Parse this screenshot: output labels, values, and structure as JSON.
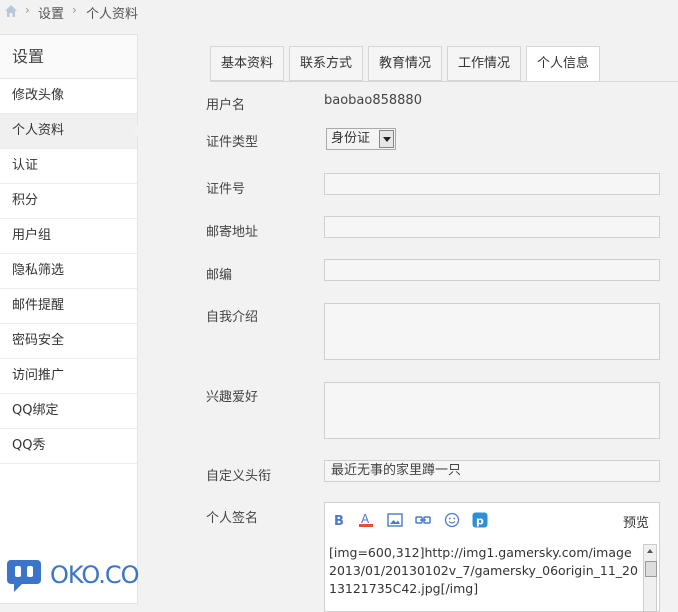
{
  "breadcrumb": {
    "items": [
      "设置",
      "个人资料"
    ]
  },
  "sidebar": {
    "title": "设置",
    "items": [
      {
        "label": "修改头像"
      },
      {
        "label": "个人资料"
      },
      {
        "label": "认证"
      },
      {
        "label": "积分"
      },
      {
        "label": "用户组"
      },
      {
        "label": "隐私筛选"
      },
      {
        "label": "邮件提醒"
      },
      {
        "label": "密码安全"
      },
      {
        "label": "访问推广"
      },
      {
        "label": "QQ绑定"
      },
      {
        "label": "QQ秀"
      }
    ],
    "active_index": 1
  },
  "tabs": [
    {
      "label": "基本资料"
    },
    {
      "label": "联系方式"
    },
    {
      "label": "教育情况"
    },
    {
      "label": "工作情况"
    },
    {
      "label": "个人信息"
    }
  ],
  "form": {
    "username_label": "用户名",
    "username_value": "baobao858880",
    "idtype_label": "证件类型",
    "idtype_value": "身份证",
    "idnumber_label": "证件号",
    "address_label": "邮寄地址",
    "zip_label": "邮编",
    "bio_label": "自我介绍",
    "interests_label": "兴趣爱好",
    "title_label": "自定义头衔",
    "title_value": "最近无事的家里蹲一只",
    "signature_label": "个人签名",
    "signature_value": "[img=600,312]http://img1.gamersky.com/image2013/01/20130102v_7/gamersky_06origin_11_2013121735C42.jpg[/img]",
    "preview_label": "预览"
  },
  "watermark": {
    "text": "OKO.CO"
  },
  "colors": {
    "accent": "#2f66c8",
    "watermark": "#3b74c9"
  }
}
